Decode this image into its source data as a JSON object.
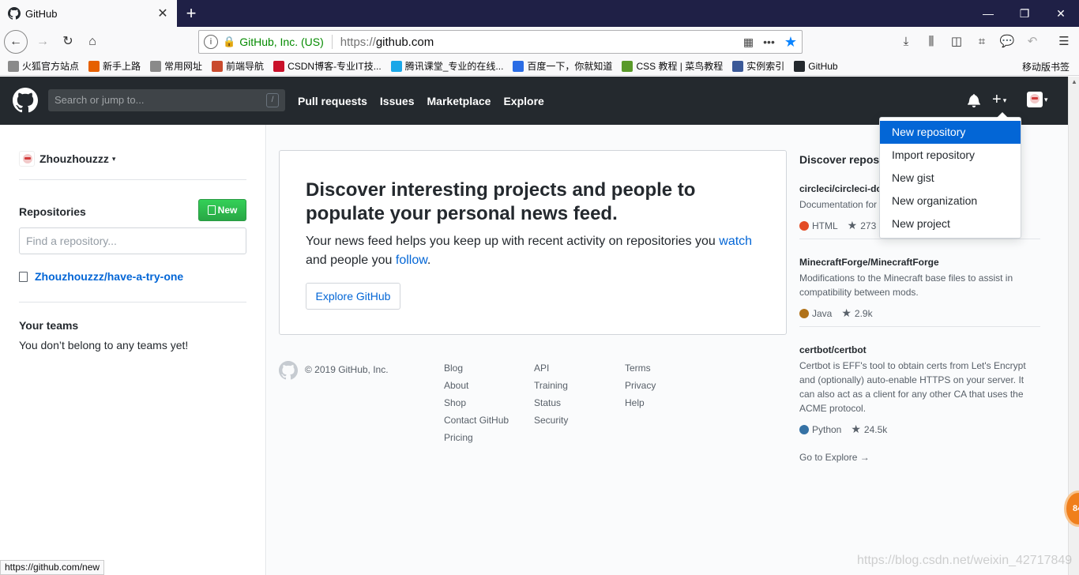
{
  "browser": {
    "tab_title": "GitHub",
    "tab_close": "✕",
    "new_tab": "+",
    "window": {
      "minimize": "—",
      "restore": "❐",
      "close": "✕"
    },
    "url": {
      "org": "GitHub, Inc. (US)",
      "scheme": "https://",
      "host": "github.com"
    },
    "bookmarks": [
      {
        "label": "火狐官方站点",
        "color": "#8a8a8a"
      },
      {
        "label": "新手上路",
        "color": "#e66000"
      },
      {
        "label": "常用网址",
        "color": "#8a8a8a"
      },
      {
        "label": "前端导航",
        "color": "#c94b2e"
      },
      {
        "label": "CSDN博客-专业IT技...",
        "color": "#c9112a"
      },
      {
        "label": "腾讯课堂_专业的在线...",
        "color": "#1aa7e8"
      },
      {
        "label": "百度一下，你就知道",
        "color": "#2b6de5"
      },
      {
        "label": "CSS 教程 | 菜鸟教程",
        "color": "#5a9a2a"
      },
      {
        "label": "实例索引",
        "color": "#3b5998"
      },
      {
        "label": "GitHub",
        "color": "#24292e"
      }
    ],
    "mobile_bookmarks": "移动版书签",
    "status_url": "https://github.com/new"
  },
  "header": {
    "search_placeholder": "Search or jump to...",
    "slash": "/",
    "nav": [
      "Pull requests",
      "Issues",
      "Marketplace",
      "Explore"
    ],
    "plus": "+"
  },
  "sidebar": {
    "username": "Zhouzhouzzz",
    "repos_title": "Repositories",
    "new_button": "New",
    "find_placeholder": "Find a repository...",
    "repos": [
      "Zhouzhouzzz/have-a-try-one"
    ],
    "teams_title": "Your teams",
    "teams_text": "You don’t belong to any teams yet!"
  },
  "main": {
    "heading": "Discover interesting projects and people to populate your personal news feed.",
    "text_before_watch": "Your news feed helps you keep up with recent activity on repositories you ",
    "watch": "watch",
    "text_mid": " and people you ",
    "follow": "follow",
    "text_end": ".",
    "explore_button": "Explore GitHub"
  },
  "footer": {
    "copyright": "© 2019 GitHub, Inc.",
    "col1": [
      "Blog",
      "About",
      "Shop",
      "Contact GitHub",
      "Pricing"
    ],
    "col2": [
      "API",
      "Training",
      "Status",
      "Security"
    ],
    "col3": [
      "Terms",
      "Privacy",
      "Help"
    ]
  },
  "discover": {
    "title": "Discover reposit",
    "repos": [
      {
        "name": "circleci/circleci-doc",
        "desc": "Documentation for",
        "lang": "HTML",
        "color": "#e34c26",
        "stars": "273"
      },
      {
        "name": "MinecraftForge/MinecraftForge",
        "desc": "Modifications to the Minecraft base files to assist in compatibility between mods.",
        "lang": "Java",
        "color": "#b07219",
        "stars": "2.9k"
      },
      {
        "name": "certbot/certbot",
        "desc": "Certbot is EFF's tool to obtain certs from Let's Encrypt and (optionally) auto-enable HTTPS on your server. It can also act as a client for any other CA that uses the ACME protocol.",
        "lang": "Python",
        "color": "#3572a5",
        "stars": "24.5k"
      }
    ],
    "go_explore": "Go to Explore →"
  },
  "dropdown": {
    "items": [
      "New repository",
      "Import repository",
      "New gist",
      "New organization",
      "New project"
    ],
    "active_index": 0
  },
  "overlay": {
    "watermark": "https://blog.csdn.net/weixin_42717849",
    "badge": "84"
  }
}
